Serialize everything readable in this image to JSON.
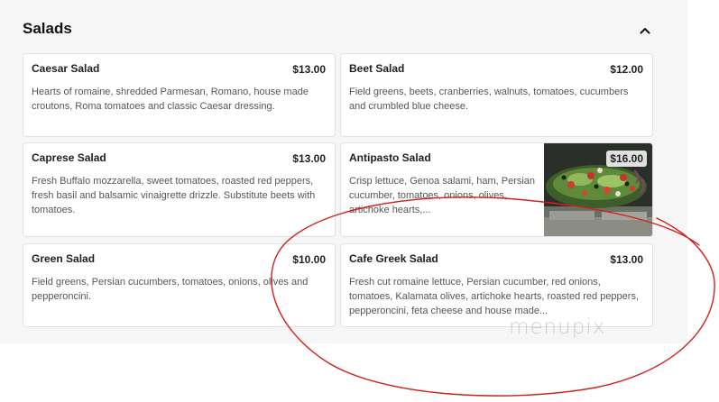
{
  "section": {
    "title": "Salads"
  },
  "items": [
    {
      "name": "Caesar Salad",
      "price": "$13.00",
      "description": "Hearts of romaine, shredded Parmesan, Romano, house made croutons, Roma tomatoes and classic Caesar dressing."
    },
    {
      "name": "Beet Salad",
      "price": "$12.00",
      "description": "Field greens, beets, cranberries, walnuts, tomatoes, cucumbers and crumbled blue cheese."
    },
    {
      "name": "Caprese Salad",
      "price": "$13.00",
      "description": "Fresh Buffalo mozzarella, sweet tomatoes, roasted red peppers, fresh basil and balsamic vinaigrette drizzle. Substitute beets with tomatoes."
    },
    {
      "name": "Antipasto Salad",
      "price": "$16.00",
      "description": "Crisp lettuce, Genoa salami, ham, Persian cucumber, tomatoes, onions, olives, artichoke hearts,..."
    },
    {
      "name": "Green Salad",
      "price": "$10.00",
      "description": "Field greens, Persian cucumbers, tomatoes, onions, olives and pepperoncini."
    },
    {
      "name": "Cafe Greek Salad",
      "price": "$13.00",
      "description": "Fresh cut romaine lettuce, Persian cucumber, red onions, tomatoes, Kalamata olives, artichoke hearts, roasted red peppers, pepperoncini, feta cheese and house made..."
    }
  ],
  "watermark": "menupix",
  "icons": {
    "collapse": "chevron-up-icon",
    "photo": "salad-photo"
  },
  "colors": {
    "panel_bg": "#f6f6f6",
    "card_border": "#e1e1e1",
    "annotation": "#d21f1f"
  }
}
